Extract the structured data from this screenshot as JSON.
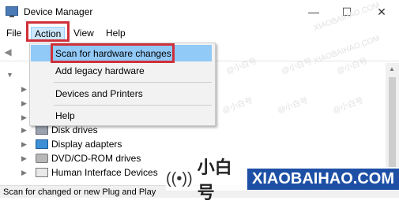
{
  "window": {
    "title": "Device Manager"
  },
  "menubar": {
    "items": [
      "File",
      "Action",
      "View",
      "Help"
    ]
  },
  "action_menu": {
    "items": [
      "Scan for hardware changes",
      "Add legacy hardware",
      "Devices and Printers",
      "Help"
    ]
  },
  "tree": {
    "items": [
      "Disk drives",
      "Display adapters",
      "DVD/CD-ROM drives",
      "Human Interface Devices"
    ]
  },
  "statusbar": {
    "text": "Scan for changed or new Plug and Play"
  },
  "watermark": {
    "text": "@小白号",
    "brand_cn": "小白号",
    "brand_en": "XIAOBAIHAO.COM",
    "site": "XIAOBAIHAO.COM"
  },
  "colors": {
    "highlight_box": "#d0303a",
    "menu_hover": "#91c9f7",
    "brand_blue": "#1d4fa5"
  }
}
